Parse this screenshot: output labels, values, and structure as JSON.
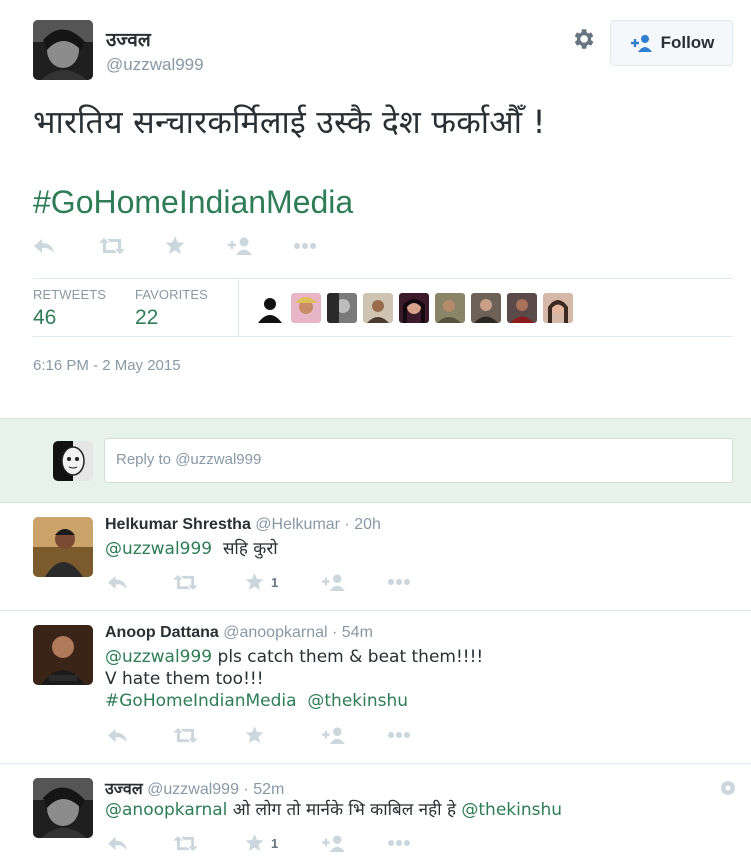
{
  "tweet": {
    "author_name": "उज्वल",
    "author_handle": "@uzzwal999",
    "text": "भारतिय सन्चारकर्मिलाई उस्कै देश फर्काऔँ !",
    "hashtag": "#GoHomeIndianMedia",
    "follow_label": "Follow",
    "stats": {
      "retweets_label": "RETWEETS",
      "retweets_count": "46",
      "favorites_label": "FAVORITES",
      "favorites_count": "22"
    },
    "timestamp": "6:16 PM - 2 May 2015"
  },
  "reply_box": {
    "placeholder": "Reply to @uzzwal999"
  },
  "replies": [
    {
      "name": "Helkumar Shrestha",
      "handle": "@Helkumar",
      "time": "· 20h",
      "mention": "@uzzwal999",
      "text": "सहि कुरो",
      "favorite_count": "1"
    },
    {
      "name": "Anoop Dattana",
      "handle": "@anoopkarnal",
      "time": "· 54m",
      "mention": "@uzzwal999",
      "line1_rest": "pls catch them & beat them!!!!",
      "line2": "V hate them too!!!",
      "hashtag": "#GoHomeIndianMedia",
      "mention2": "@thekinshu"
    },
    {
      "name": "उज्वल",
      "handle": "@uzzwal999",
      "time": "· 52m",
      "mention": "@anoopkarnal",
      "text": "ओ लोग तो मार्नके  भि काबिल नही हे ",
      "mention2": "@thekinshu",
      "favorite_count": "1"
    }
  ],
  "colors": {
    "link": "#2e7d57",
    "muted": "#8899a6",
    "text": "#292f33",
    "reply_bar": "#e8f2ec"
  }
}
